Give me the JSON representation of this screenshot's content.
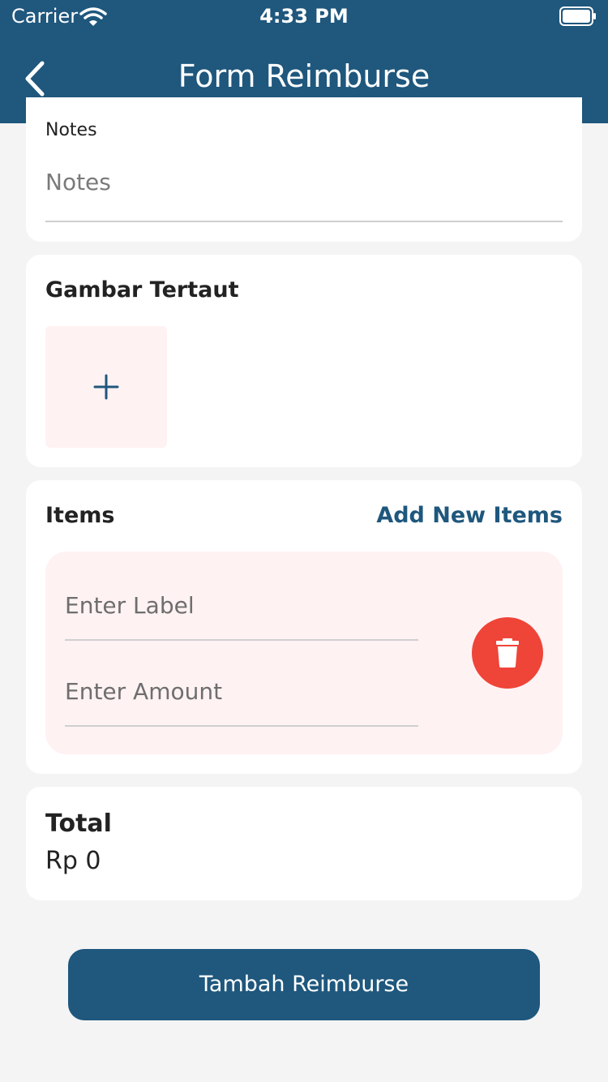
{
  "status_bar": {
    "carrier": "Carrier",
    "time": "4:33 PM",
    "icons": [
      "wifi-icon",
      "battery-icon"
    ]
  },
  "header": {
    "title": "Form Reimburse",
    "back_icon": "chevron-left-icon",
    "background": "#1f577d"
  },
  "notes": {
    "label": "Notes",
    "placeholder": "Notes"
  },
  "images": {
    "title": "Gambar Tertaut",
    "add_icon": "plus-icon"
  },
  "items": {
    "title": "Items",
    "add_label": "Add New Items",
    "entries": [
      {
        "label_placeholder": "Enter Label",
        "amount_placeholder": "Enter Amount",
        "delete_icon": "trash-icon"
      }
    ]
  },
  "total": {
    "label": "Total",
    "value": "Rp 0"
  },
  "submit": {
    "label": "Tambah Reimburse"
  },
  "colors": {
    "primary": "#1f577d",
    "danger": "#ef4438",
    "item_background": "#fff2f3",
    "page_background": "#f4f4f4"
  }
}
